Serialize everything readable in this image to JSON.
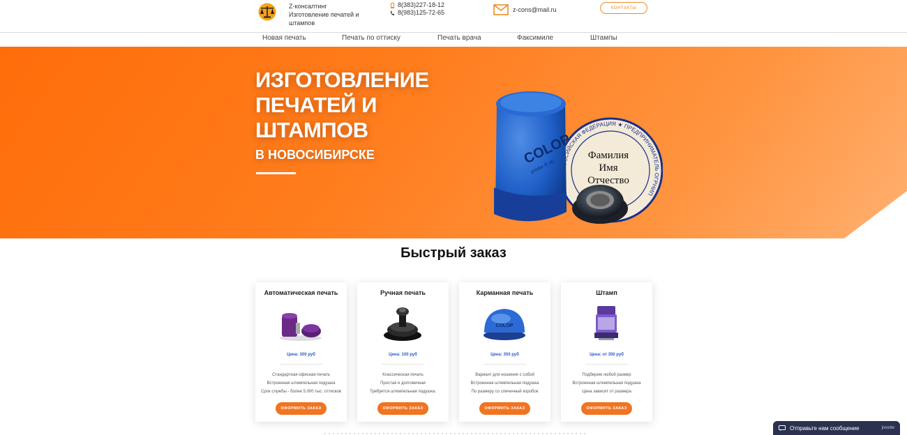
{
  "header": {
    "brand_lines": [
      "Z-консалтинг",
      "Изготовление печатей и",
      "штампов"
    ],
    "phones": [
      "8(383)227-18-12",
      "8(983)125-72-65"
    ],
    "email": "z-cons@mail.ru",
    "contacts_label": "КОНТАКТЫ",
    "accent": "#f08a24"
  },
  "nav": [
    "Новая печать",
    "Печать по оттиску",
    "Печать врача",
    "Факсимиле",
    "Штампы"
  ],
  "hero": {
    "title_lines": [
      "ИЗГОТОВЛЕНИЕ",
      "ПЕЧАТЕЙ И",
      "ШТАМПОВ"
    ],
    "subtitle": "В НОВОСИБИРСКЕ",
    "stamp_text": [
      "Фамилия",
      "Имя",
      "Отчество"
    ],
    "ring_text": "РОССИЙСКАЯ ФЕДЕРАЦИЯ ★ ПРЕДПРИНИМАТЕЛЬ ОГРНИП",
    "brand_on_stamp": "COLOP",
    "model_on_stamp": "printer R 40",
    "gradient": [
      "#ff6d0a",
      "#ffb070"
    ]
  },
  "quick_order": {
    "title": "Быстрый заказ",
    "cards": [
      {
        "title": "Автоматическая печать",
        "price": "Цена: 300 руб",
        "desc": [
          "Стандартная офисная печать",
          "Встроенная штемпельная подушка",
          "Срок службы - более 5.000 тыс. оттисков"
        ],
        "button": "ОФОРМИТЬ ЗАКАЗ",
        "icon": "automatic-stamp-icon"
      },
      {
        "title": "Ручная печать",
        "price": "Цена: 100 руб",
        "desc": [
          "Классическая печать",
          "Простая и долговечная",
          "Требуется штемпельная подушка."
        ],
        "button": "ОФОРМИТЬ ЗАКАЗ",
        "icon": "hand-stamp-icon"
      },
      {
        "title": "Карманная печать",
        "price": "Цена: 350 руб",
        "desc": [
          "Вариант для ношения с собой",
          "Встроенная штемпельная подушка",
          "По размеру со спичечный коробок"
        ],
        "button": "ОФОРМИТЬ ЗАКАЗ",
        "icon": "pocket-stamp-icon"
      },
      {
        "title": "Штамп",
        "price": "Цена: от 350 руб",
        "desc": [
          "Подберем любой размер",
          "Встроенная штемпельная подушка",
          "Цена зависит от размера"
        ],
        "button": "ОФОРМИТЬ ЗАКАЗ",
        "icon": "rectangle-stamp-icon"
      }
    ]
  },
  "chat": {
    "label": "Отправьте нам сообщение",
    "brand": "jivosite"
  }
}
